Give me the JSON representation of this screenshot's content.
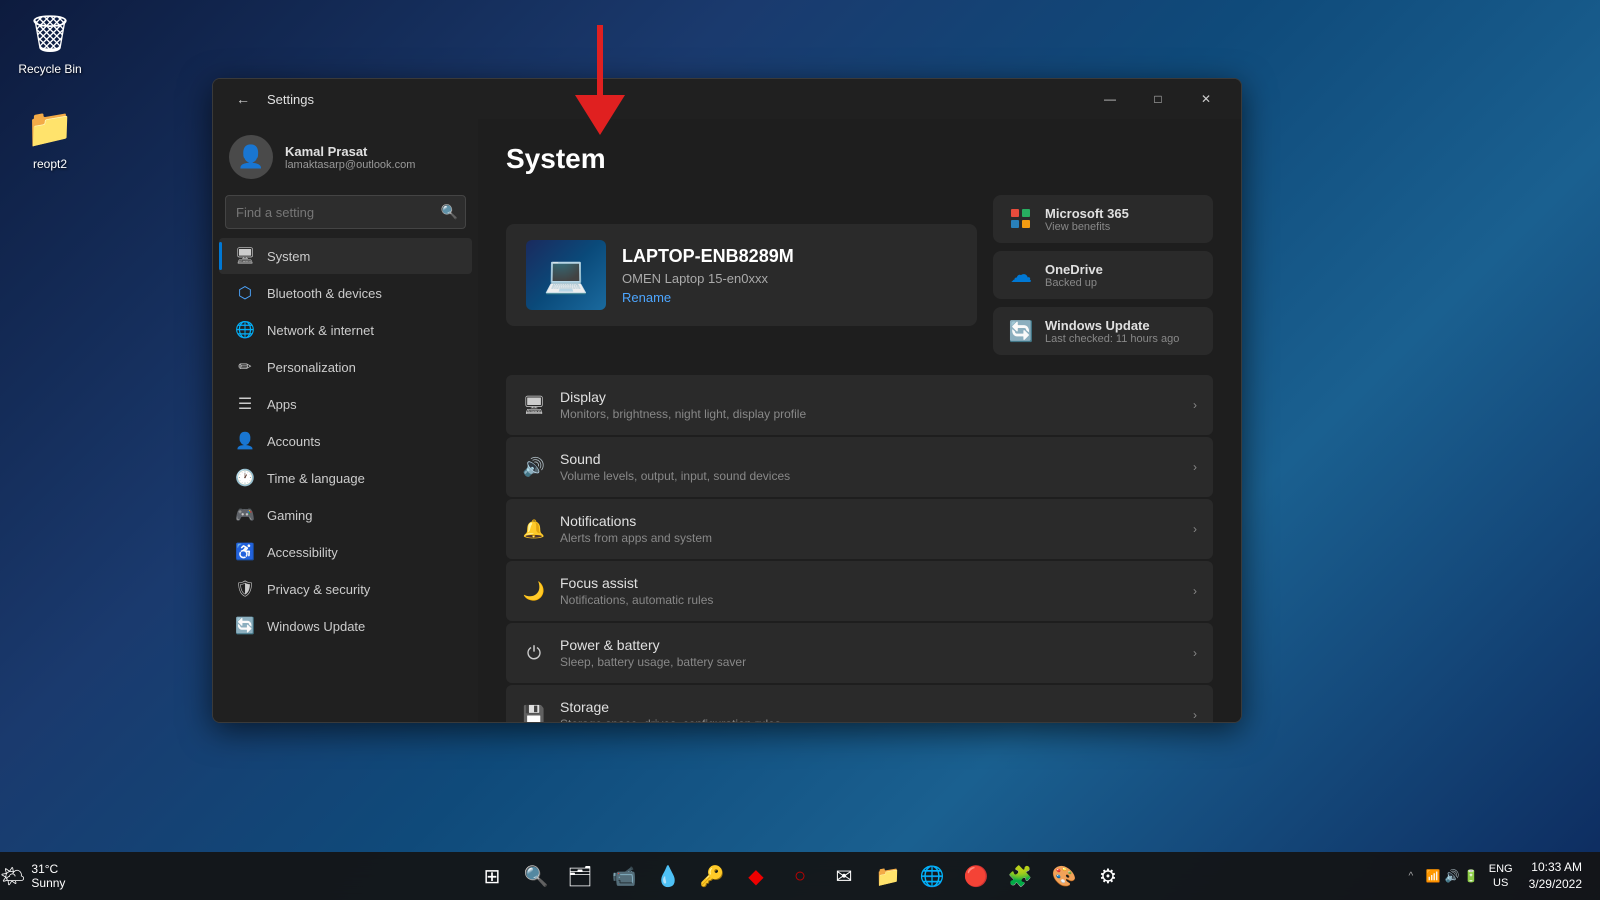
{
  "desktop": {
    "recycle_bin_label": "Recycle Bin",
    "folder_label": "reopt2"
  },
  "window": {
    "title": "Settings",
    "minimize_label": "—",
    "maximize_label": "□",
    "close_label": "✕"
  },
  "user": {
    "name": "Kamal Prasat",
    "email": "lamaktasarp@outlook.com"
  },
  "search": {
    "placeholder": "Find a setting"
  },
  "nav": {
    "items": [
      {
        "id": "system",
        "label": "System",
        "icon": "🖥",
        "active": true
      },
      {
        "id": "bluetooth",
        "label": "Bluetooth & devices",
        "icon": "🔷",
        "active": false
      },
      {
        "id": "network",
        "label": "Network & internet",
        "icon": "🌐",
        "active": false
      },
      {
        "id": "personalization",
        "label": "Personalization",
        "icon": "✏️",
        "active": false
      },
      {
        "id": "apps",
        "label": "Apps",
        "icon": "📱",
        "active": false
      },
      {
        "id": "accounts",
        "label": "Accounts",
        "icon": "👤",
        "active": false
      },
      {
        "id": "time",
        "label": "Time & language",
        "icon": "🕐",
        "active": false
      },
      {
        "id": "gaming",
        "label": "Gaming",
        "icon": "🎮",
        "active": false
      },
      {
        "id": "accessibility",
        "label": "Accessibility",
        "icon": "♿",
        "active": false
      },
      {
        "id": "privacy",
        "label": "Privacy & security",
        "icon": "🛡",
        "active": false
      },
      {
        "id": "update",
        "label": "Windows Update",
        "icon": "🔄",
        "active": false
      }
    ]
  },
  "main": {
    "title": "System",
    "device": {
      "name": "LAPTOP-ENB8289M",
      "model": "OMEN Laptop 15-en0xxx",
      "rename_label": "Rename"
    },
    "quick_cards": [
      {
        "id": "ms365",
        "title": "Microsoft 365",
        "subtitle": "View benefits",
        "icon": "365"
      },
      {
        "id": "onedrive",
        "title": "OneDrive",
        "subtitle": "Backed up",
        "icon": "☁"
      },
      {
        "id": "winupdate",
        "title": "Windows Update",
        "subtitle": "Last checked: 11 hours ago",
        "icon": "🔄"
      }
    ],
    "settings_items": [
      {
        "id": "display",
        "icon": "🖥",
        "title": "Display",
        "desc": "Monitors, brightness, night light, display profile"
      },
      {
        "id": "sound",
        "icon": "🔊",
        "title": "Sound",
        "desc": "Volume levels, output, input, sound devices"
      },
      {
        "id": "notifications",
        "icon": "🔔",
        "title": "Notifications",
        "desc": "Alerts from apps and system"
      },
      {
        "id": "focus",
        "icon": "🌙",
        "title": "Focus assist",
        "desc": "Notifications, automatic rules"
      },
      {
        "id": "power",
        "icon": "⏻",
        "title": "Power & battery",
        "desc": "Sleep, battery usage, battery saver"
      },
      {
        "id": "storage",
        "icon": "💾",
        "title": "Storage",
        "desc": "Storage space, drives, configuration rules"
      }
    ]
  },
  "taskbar": {
    "weather": {
      "temp": "31°C",
      "condition": "Sunny"
    },
    "clock": {
      "time": "10:33 AM",
      "date": "3/29/2022"
    },
    "lang": {
      "line1": "ENG",
      "line2": "US"
    },
    "icons": [
      "⊞",
      "🗂",
      "📹",
      "💧",
      "🔑",
      "◆",
      "○",
      "✉",
      "📁",
      "🌐",
      "🔴",
      "🧩",
      "🎨",
      "⚙"
    ]
  }
}
